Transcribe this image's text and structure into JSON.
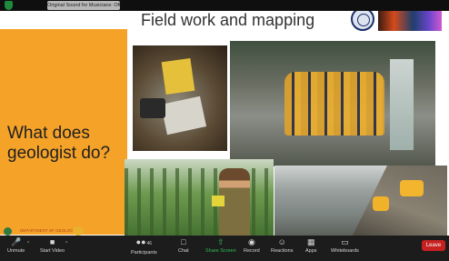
{
  "topbar": {
    "sound_notice": "Original Sound for Musicians: Off",
    "shield_color": "#1e8a3c"
  },
  "slide": {
    "title": "Field work and mapping",
    "question": "What does geologist do?",
    "question_lines": [
      "What does",
      "geologist do?"
    ],
    "logo_text": "DEPARTMENT OF GEOLOGY",
    "accent_color": "#f5a229"
  },
  "toolbar": {
    "unmute": "Unmute",
    "start_video": "Start Video",
    "participants": "Participants",
    "participant_count": "46",
    "chat": "Chat",
    "share_screen": "Share Screen",
    "record": "Record",
    "reactions": "Reactions",
    "apps": "Apps",
    "whiteboards": "Whiteboards",
    "leave": "Leave",
    "share_color": "#2fbf56",
    "leave_color": "#c62020"
  },
  "icons": {
    "unmute": "microphone-muted-icon",
    "video": "video-off-icon",
    "participants": "people-icon",
    "chat": "chat-bubble-icon",
    "share": "share-screen-icon",
    "record": "record-icon",
    "reactions": "smiley-icon",
    "apps": "apps-grid-icon",
    "whiteboards": "whiteboard-icon"
  }
}
